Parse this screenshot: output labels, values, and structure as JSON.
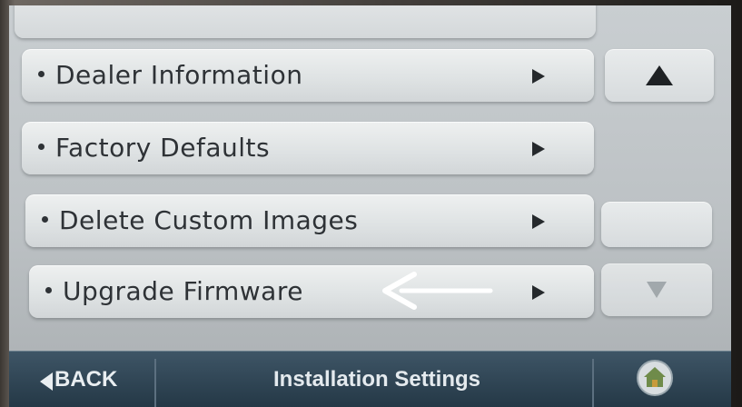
{
  "menu": {
    "items": [
      {
        "label": "Dealer Information",
        "icon": "chevron-right-icon"
      },
      {
        "label": "Factory Defaults",
        "icon": "chevron-right-icon"
      },
      {
        "label": "Delete Custom Images",
        "icon": "chevron-right-icon"
      },
      {
        "label": "Upgrade Firmware",
        "icon": "chevron-right-icon"
      }
    ]
  },
  "scroll": {
    "up_icon": "scroll-up-icon",
    "down_icon": "scroll-down-icon"
  },
  "annotation": {
    "icon": "arrow-left-icon",
    "color": "#ffffff"
  },
  "footer": {
    "back_label": "BACK",
    "back_icon": "back-arrow-icon",
    "title": "Installation Settings",
    "home_icon": "home-icon"
  },
  "colors": {
    "screen_background": "#c3c8cb",
    "button_face": "#e3e6e7",
    "footer_bar": "#2f4553",
    "footer_text": "#e6ebee"
  }
}
